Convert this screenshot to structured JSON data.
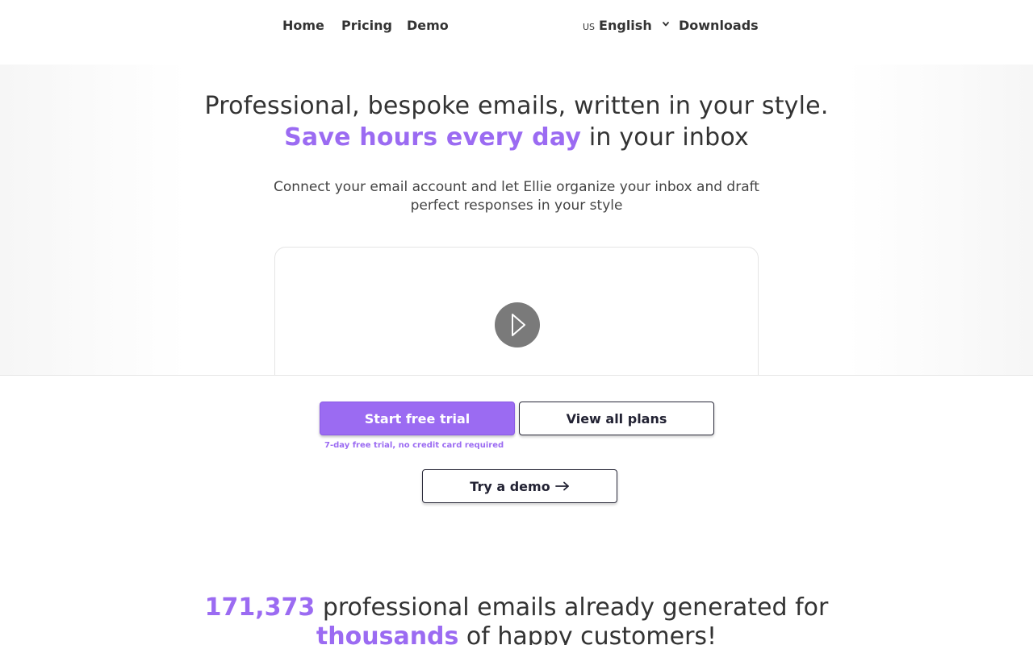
{
  "nav": {
    "items": [
      {
        "label": "Home"
      },
      {
        "label": "Pricing"
      },
      {
        "label": "Demo"
      }
    ],
    "language": {
      "flag": "US",
      "label": "English"
    },
    "downloads": "Downloads"
  },
  "hero": {
    "headline_part1": "Professional, bespoke emails, written in your style. ",
    "headline_accent": "Save hours every day",
    "headline_part2": " in your inbox",
    "subhead": "Connect your email account and let Ellie organize your inbox and draft perfect responses in your style"
  },
  "video": {
    "play_icon": "play-icon"
  },
  "cta": {
    "start_trial": "Start free trial",
    "view_plans": "View all plans",
    "trial_note": "7-day free trial, no credit card required",
    "try_demo": "Try a demo"
  },
  "stats": {
    "count": "171,373",
    "text1": " professional emails already generated for ",
    "thousands": "thousands",
    "text2": " of happy customers!"
  },
  "colors": {
    "accent": "#9b6bf2",
    "text": "#333333",
    "play_button": "#7a7a7a"
  }
}
